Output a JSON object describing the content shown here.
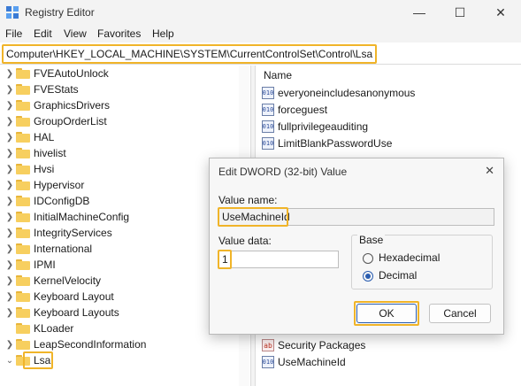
{
  "window": {
    "title": "Registry Editor",
    "controls": {
      "minimize": "—",
      "maximize": "☐",
      "close": "✕"
    }
  },
  "menu": [
    "File",
    "Edit",
    "View",
    "Favorites",
    "Help"
  ],
  "address": "Computer\\HKEY_LOCAL_MACHINE\\SYSTEM\\CurrentControlSet\\Control\\Lsa",
  "tree": {
    "items": [
      {
        "label": "FVEAutoUnlock",
        "expanded": false
      },
      {
        "label": "FVEStats",
        "expanded": false
      },
      {
        "label": "GraphicsDrivers",
        "expanded": false
      },
      {
        "label": "GroupOrderList",
        "expanded": false
      },
      {
        "label": "HAL",
        "expanded": false
      },
      {
        "label": "hivelist",
        "expanded": false
      },
      {
        "label": "Hvsi",
        "expanded": false
      },
      {
        "label": "Hypervisor",
        "expanded": false
      },
      {
        "label": "IDConfigDB",
        "expanded": false
      },
      {
        "label": "InitialMachineConfig",
        "expanded": false
      },
      {
        "label": "IntegrityServices",
        "expanded": false
      },
      {
        "label": "International",
        "expanded": false
      },
      {
        "label": "IPMI",
        "expanded": false
      },
      {
        "label": "KernelVelocity",
        "expanded": false
      },
      {
        "label": "Keyboard Layout",
        "expanded": false
      },
      {
        "label": "Keyboard Layouts",
        "expanded": false
      },
      {
        "label": "KLoader",
        "expanded": false
      },
      {
        "label": "LeapSecondInformation",
        "expanded": false
      },
      {
        "label": "Lsa",
        "expanded": true,
        "selected": true
      }
    ]
  },
  "values": {
    "column_name": "Name",
    "top_rows": [
      {
        "name": "everyoneincludesanonymous",
        "icon": "dword-icon"
      },
      {
        "name": "forceguest",
        "icon": "dword-icon"
      },
      {
        "name": "fullprivilegeauditing",
        "icon": "dword-icon"
      },
      {
        "name": "LimitBlankPasswordUse",
        "icon": "dword-icon"
      }
    ],
    "bottom_rows": [
      {
        "name": "Security Packages",
        "icon": "string-icon"
      },
      {
        "name": "UseMachineId",
        "icon": "dword-icon"
      }
    ]
  },
  "dialog": {
    "title": "Edit DWORD (32-bit) Value",
    "close": "✕",
    "value_name_label": "Value name:",
    "value_name": "UseMachineId",
    "value_data_label": "Value data:",
    "value_data": "1",
    "base_label": "Base",
    "hex_label": "Hexadecimal",
    "dec_label": "Decimal",
    "base_selected": "Decimal",
    "ok_label": "OK",
    "cancel_label": "Cancel"
  },
  "colors": {
    "highlight": "#f0b429",
    "folder": "#f7cf5f",
    "accent": "#2a5db0"
  }
}
